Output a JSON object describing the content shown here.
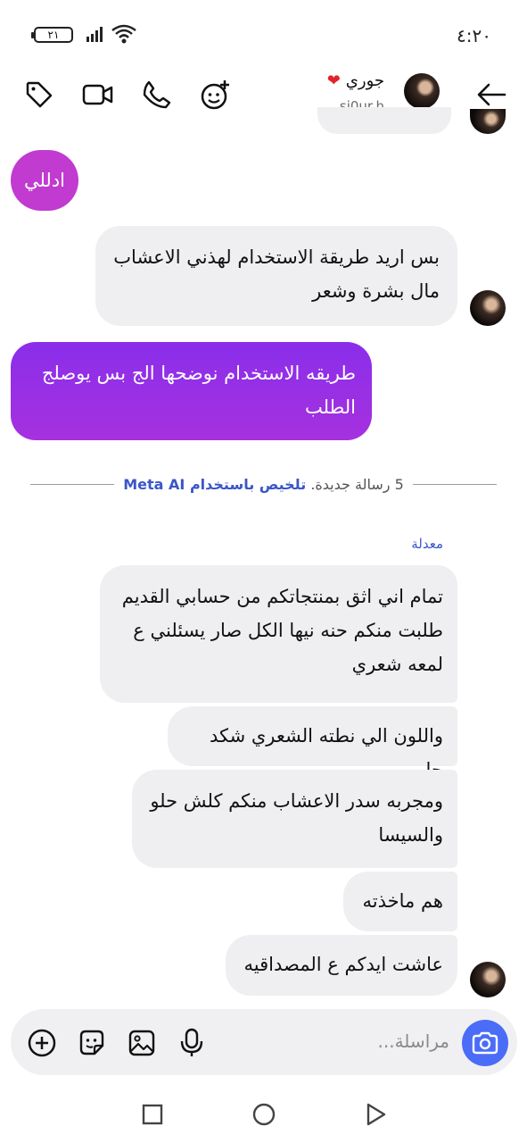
{
  "status_bar": {
    "time": "٤:٢٠",
    "battery": "٢١"
  },
  "header": {
    "contact_name": "جوري",
    "contact_handle": "sj0ur.h",
    "heart_emoji": "❤",
    "icons": [
      "back-arrow-icon",
      "tag-icon",
      "video-call-icon",
      "phone-icon",
      "add-effect-icon"
    ]
  },
  "messages": [
    {
      "id": "m1",
      "direction": "outgoing",
      "text": "ادللي",
      "color": "#c13bd0"
    },
    {
      "id": "m2",
      "direction": "incoming",
      "lines": [
        "بس اريد طريقة الاستخدام لهذني الاعشاب",
        "مال بشرة وشعر"
      ]
    },
    {
      "id": "m3",
      "direction": "outgoing",
      "lines": [
        "طريقه الاستخدام نوضحها الج بس يوصلج",
        "الطلب"
      ],
      "color": "#9b2fe3"
    },
    {
      "id": "m4",
      "direction": "incoming",
      "lines": [
        "تمام اني اثق بمنتجاتكم من حسابي القديم",
        "طلبت منكم حنه نيها الكل صار يسئلني ع",
        "لمعه شعري"
      ],
      "edited_label": "معدلة"
    },
    {
      "id": "m5",
      "direction": "incoming",
      "lines": [
        "واللون الي نطته الشعري شكد حلو"
      ]
    },
    {
      "id": "m6",
      "direction": "incoming",
      "lines": [
        "ومجربه سدر الاعشاب منكم كلش حلو",
        "والسيسا"
      ]
    },
    {
      "id": "m7",
      "direction": "incoming",
      "lines": [
        "هم ماخذته"
      ]
    },
    {
      "id": "m8",
      "direction": "incoming",
      "lines": [
        "عاشت ايدكم ع المصداقيه"
      ]
    }
  ],
  "divider": {
    "count_text": "5 رسالة جديدة.",
    "link_text": "تلخيص باستخدام Meta AI"
  },
  "composer": {
    "placeholder": "مراسلة..."
  },
  "colors": {
    "accent": "#4a6cf7",
    "link": "#3a56c7",
    "incoming_bubble": "#efeff1"
  }
}
